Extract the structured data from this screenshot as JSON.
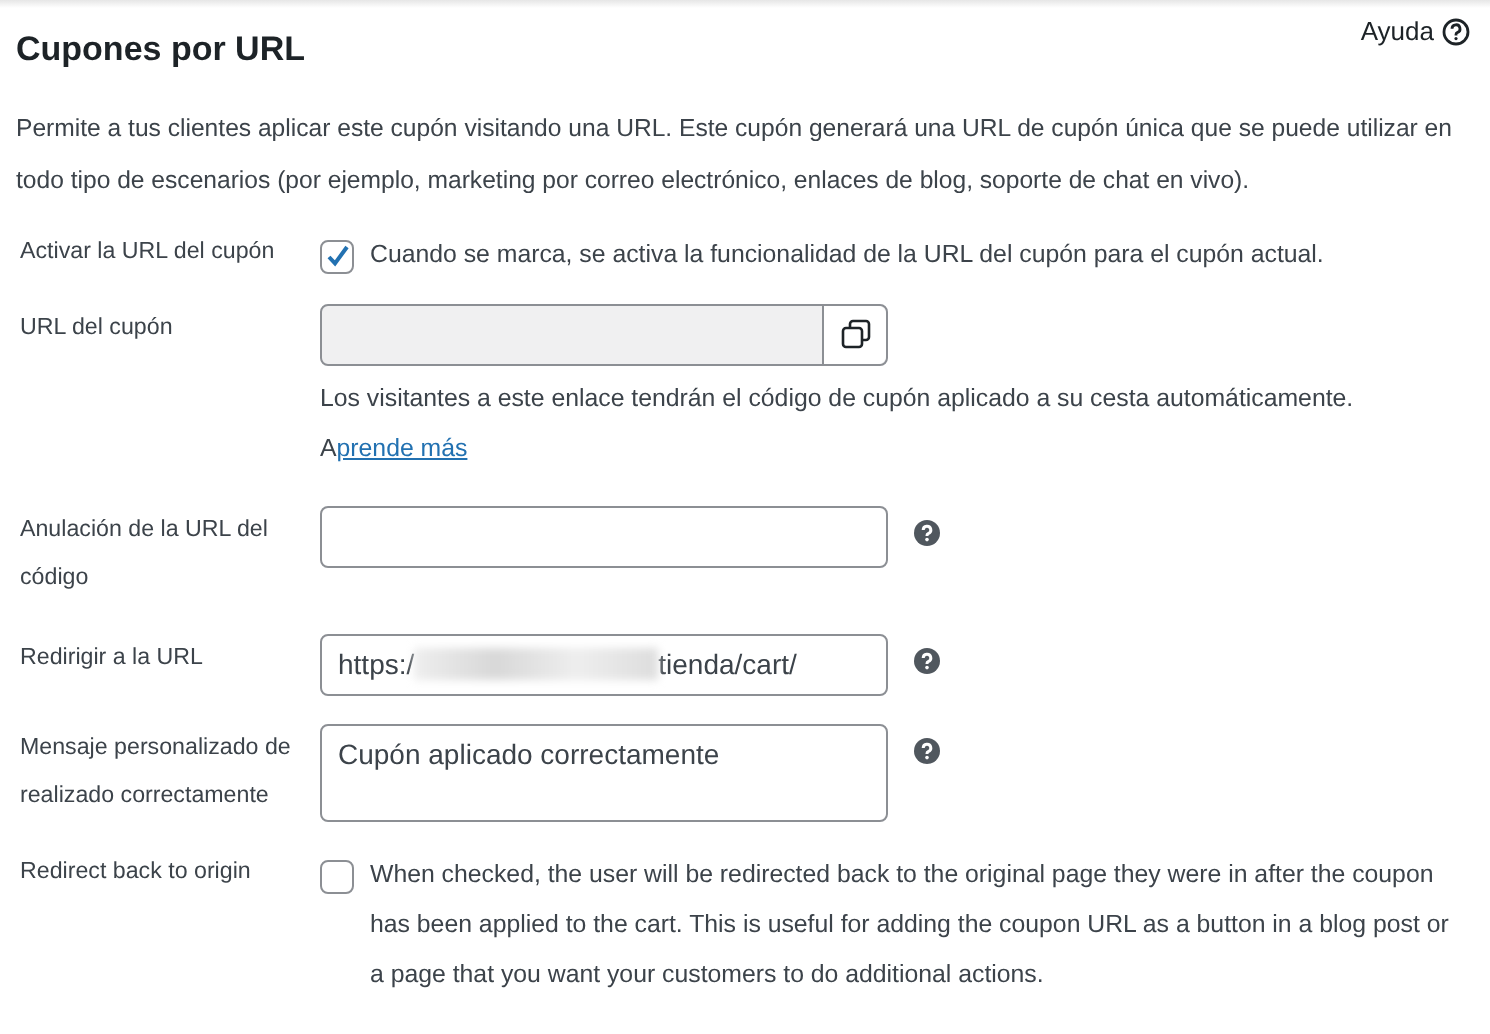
{
  "header": {
    "title": "Cupones por URL",
    "help_link": "Ayuda"
  },
  "intro": "Permite a tus clientes aplicar este cupón visitando una URL. Este cupón generará una URL de cupón única que se puede utilizar en todo tipo de escenarios (por ejemplo, marketing por correo electrónico, enlaces de blog, soporte de chat en vivo).",
  "fields": [
    {
      "kind": "checkbox",
      "label": "Activar la URL del cupón",
      "checked": true,
      "description": "Cuando se marca, se activa la funcionalidad de la URL del cupón para el cupón actual."
    },
    {
      "kind": "copy_field",
      "label": "URL del cupón",
      "disabled": true,
      "description": "Los visitantes a este enlace tendrán el código de cupón aplicado a su cesta automáticamente.",
      "link_prefix": "A",
      "link": "prende más"
    },
    {
      "kind": "text",
      "label": "Anulación de la URL del código",
      "help": true
    },
    {
      "kind": "text",
      "label": "Redirigir a la URL",
      "value_start": "https:/",
      "value_end": "tienda/cart/",
      "help": true
    },
    {
      "kind": "textarea",
      "label": "Mensaje personalizado de realizado correctamente",
      "value": "Cupón aplicado correctamente",
      "help": true
    },
    {
      "kind": "checkbox",
      "label": "Redirect back to origin",
      "checked": false,
      "description": "When checked, the user will be redirected back to the original page they were in after the coupon has been applied to the cart. This is useful for adding the coupon URL as a button in a blog post or a page that you want your customers to do additional actions."
    }
  ]
}
